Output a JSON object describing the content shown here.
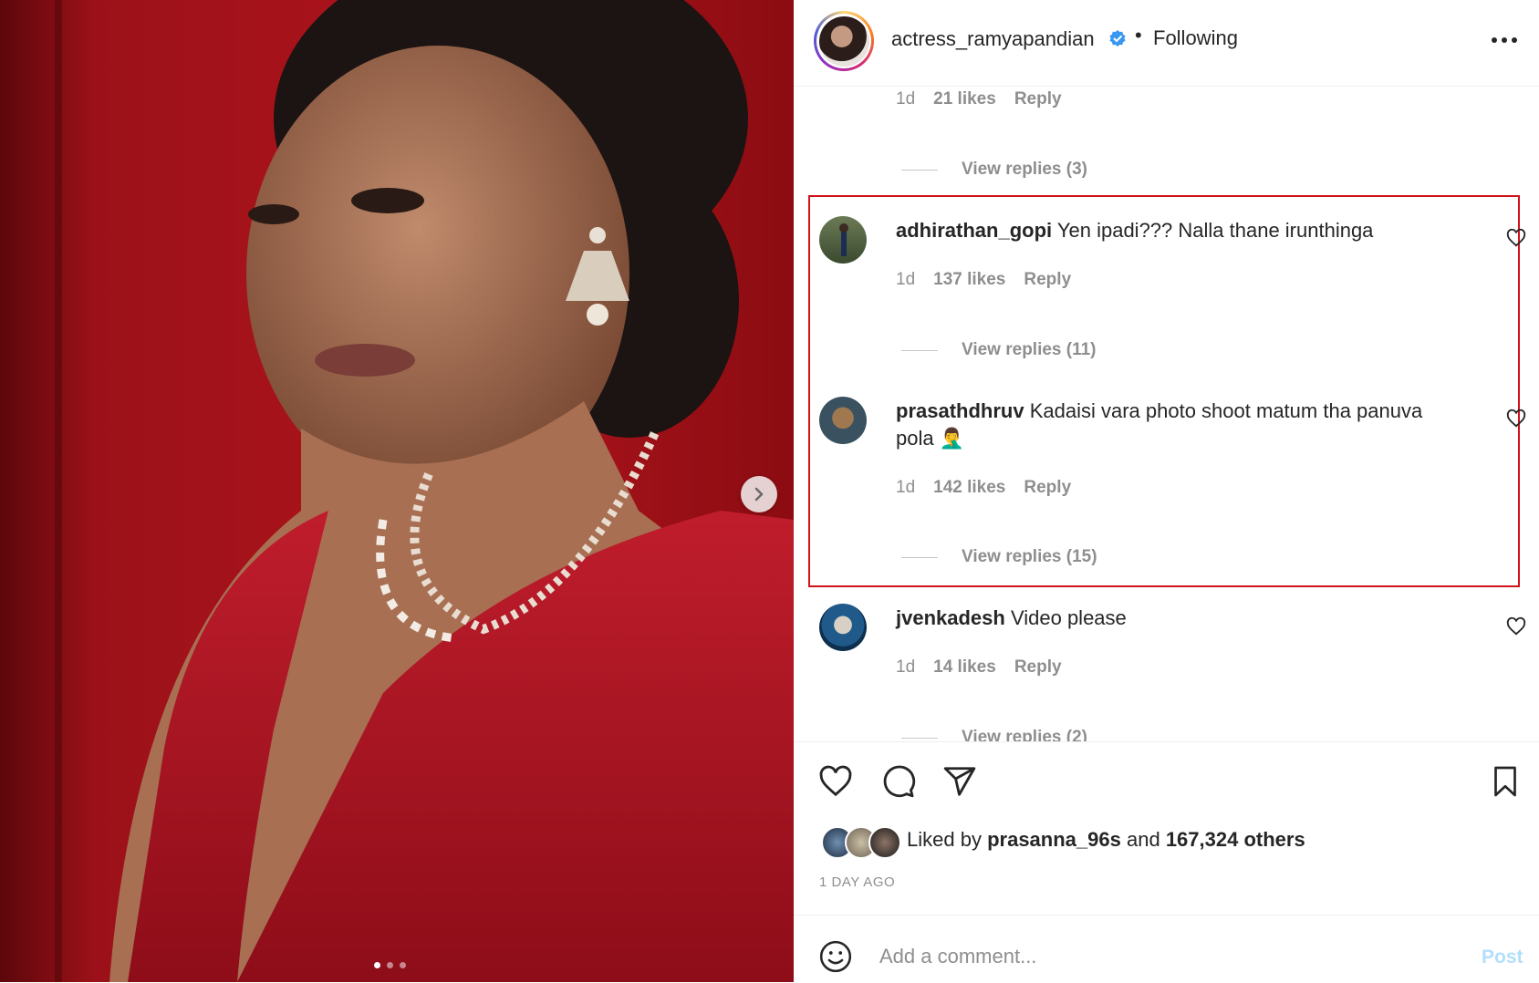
{
  "post": {
    "author": "actress_ramyapandian",
    "separator": "•",
    "follow_status": "Following",
    "photo_dots": 3,
    "photo_dot_active": 1
  },
  "comments": [
    {
      "partial": true,
      "time": "1d",
      "likes": "21 likes",
      "reply": "Reply",
      "view_replies": "View replies (3)"
    },
    {
      "username": "adhirathan_gopi",
      "text": "Yen ipadi??? Nalla thane irunthinga",
      "time": "1d",
      "likes": "137 likes",
      "reply": "Reply",
      "view_replies": "View replies (11)"
    },
    {
      "username": "prasathdhruv",
      "text": "Kadaisi vara photo shoot matum tha panuva pola 🤦‍♂️",
      "time": "1d",
      "likes": "142 likes",
      "reply": "Reply",
      "view_replies": "View replies (15)"
    },
    {
      "username": "jvenkadesh",
      "text": "Video please",
      "time": "1d",
      "likes": "14 likes",
      "reply": "Reply",
      "view_replies": "View replies (2)"
    }
  ],
  "likes_summary": {
    "prefix": "Liked by",
    "user": "prasanna_96s",
    "middle": "and",
    "others": "167,324 others"
  },
  "timestamp": "1 DAY AGO",
  "comment_box": {
    "placeholder": "Add a comment...",
    "post_label": "Post"
  },
  "colors": {
    "verified": "#3897f0",
    "highlight_border": "#d0121b",
    "post_disabled": "#b2dffc",
    "muted_text": "#8e8e8e"
  }
}
